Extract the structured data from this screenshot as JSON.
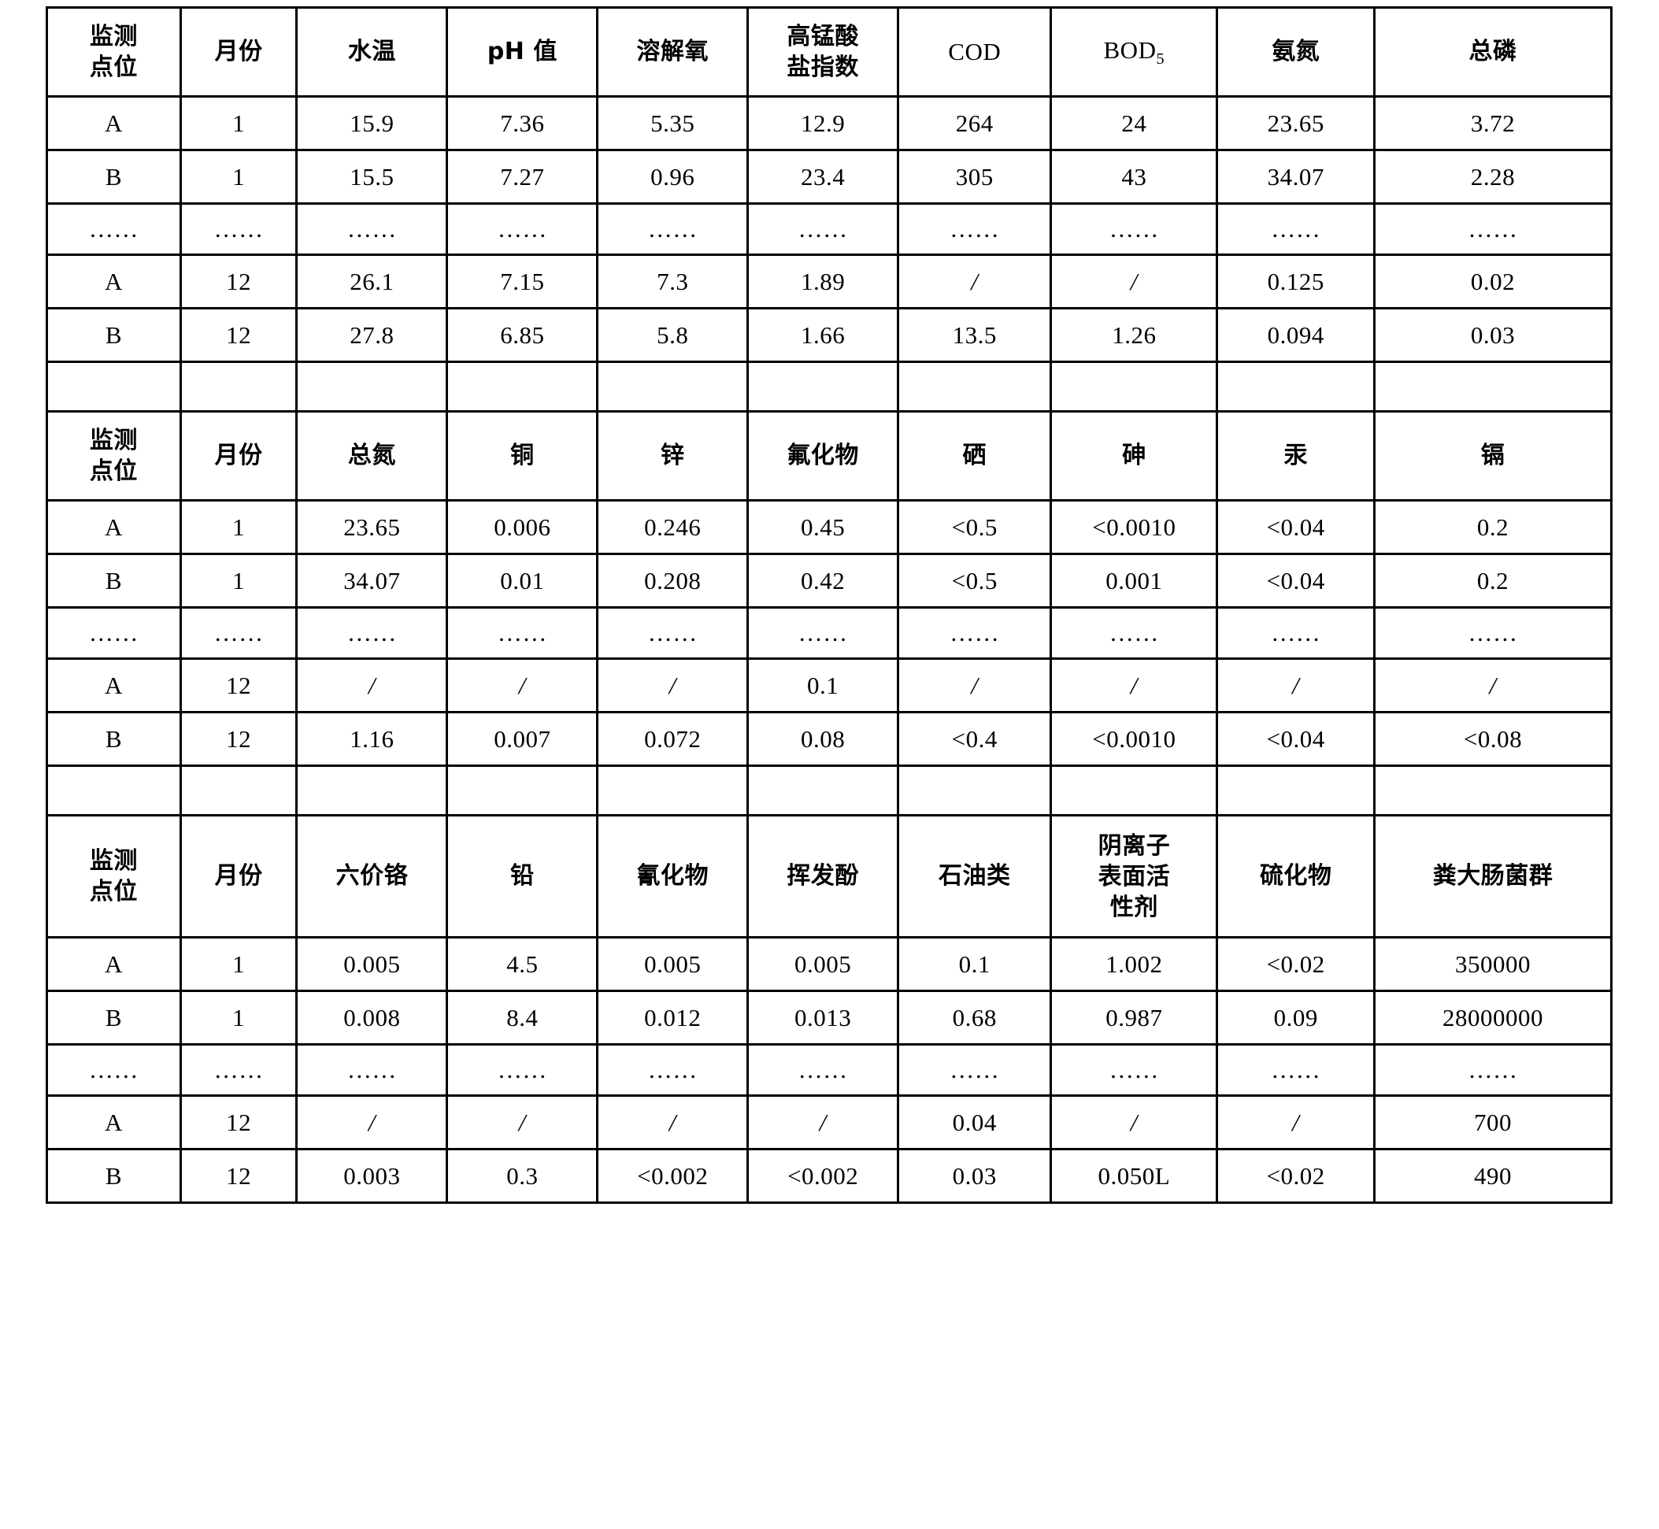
{
  "document": {
    "type": "water-quality-monitoring-data-tables",
    "table_count": 3
  },
  "tables": [
    {
      "id": "table-1",
      "headers": [
        "监测\n点位",
        "月份",
        "水温",
        "pH 值",
        "溶解氧",
        "高锰酸\n盐指数",
        "COD",
        "BOD5",
        "氨氮",
        "总磷"
      ],
      "header_lines": [
        [
          "监测",
          "点位"
        ],
        [
          "月份"
        ],
        [
          "水温"
        ],
        [
          "pH 值"
        ],
        [
          "溶解氧"
        ],
        [
          "高锰酸",
          "盐指数"
        ],
        [
          "COD"
        ],
        [
          "BOD",
          "5"
        ],
        [
          "氨氮"
        ],
        [
          "总磷"
        ]
      ],
      "rows": [
        [
          "A",
          "1",
          "15.9",
          "7.36",
          "5.35",
          "12.9",
          "264",
          "24",
          "23.65",
          "3.72"
        ],
        [
          "B",
          "1",
          "15.5",
          "7.27",
          "0.96",
          "23.4",
          "305",
          "43",
          "34.07",
          "2.28"
        ],
        [
          "……",
          "……",
          "……",
          "……",
          "……",
          "……",
          "……",
          "……",
          "……",
          "……"
        ],
        [
          "A",
          "12",
          "26.1",
          "7.15",
          "7.3",
          "1.89",
          "/",
          "/",
          "0.125",
          "0.02"
        ],
        [
          "B",
          "12",
          "27.8",
          "6.85",
          "5.8",
          "1.66",
          "13.5",
          "1.26",
          "0.094",
          "0.03"
        ]
      ]
    },
    {
      "id": "table-2",
      "headers": [
        "监测\n点位",
        "月份",
        "总氮",
        "铜",
        "锌",
        "氟化物",
        "硒",
        "砷",
        "汞",
        "镉"
      ],
      "header_lines": [
        [
          "监测",
          "点位"
        ],
        [
          "月份"
        ],
        [
          "总氮"
        ],
        [
          "铜"
        ],
        [
          "锌"
        ],
        [
          "氟化物"
        ],
        [
          "硒"
        ],
        [
          "砷"
        ],
        [
          "汞"
        ],
        [
          "镉"
        ]
      ],
      "rows": [
        [
          "A",
          "1",
          "23.65",
          "0.006",
          "0.246",
          "0.45",
          "<0.5",
          "<0.0010",
          "<0.04",
          "0.2"
        ],
        [
          "B",
          "1",
          "34.07",
          "0.01",
          "0.208",
          "0.42",
          "<0.5",
          "0.001",
          "<0.04",
          "0.2"
        ],
        [
          "……",
          "……",
          "……",
          "……",
          "……",
          "……",
          "……",
          "……",
          "……",
          "……"
        ],
        [
          "A",
          "12",
          "/",
          "/",
          "/",
          "0.1",
          "/",
          "/",
          "/",
          "/"
        ],
        [
          "B",
          "12",
          "1.16",
          "0.007",
          "0.072",
          "0.08",
          "<0.4",
          "<0.0010",
          "<0.04",
          "<0.08"
        ]
      ]
    },
    {
      "id": "table-3",
      "headers": [
        "监测\n点位",
        "月份",
        "六价铬",
        "铅",
        "氰化物",
        "挥发酚",
        "石油类",
        "阴离子\n表面活\n性剂",
        "硫化物",
        "粪大肠菌群"
      ],
      "header_lines": [
        [
          "监测",
          "点位"
        ],
        [
          "月份"
        ],
        [
          "六价铬"
        ],
        [
          "铅"
        ],
        [
          "氰化物"
        ],
        [
          "挥发酚"
        ],
        [
          "石油类"
        ],
        [
          "阴离子",
          "表面活",
          "性剂"
        ],
        [
          "硫化物"
        ],
        [
          "粪大肠菌群"
        ]
      ],
      "rows": [
        [
          "A",
          "1",
          "0.005",
          "4.5",
          "0.005",
          "0.005",
          "0.1",
          "1.002",
          "<0.02",
          "350000"
        ],
        [
          "B",
          "1",
          "0.008",
          "8.4",
          "0.012",
          "0.013",
          "0.68",
          "0.987",
          "0.09",
          "28000000"
        ],
        [
          "……",
          "……",
          "……",
          "……",
          "……",
          "……",
          "……",
          "……",
          "……",
          "……"
        ],
        [
          "A",
          "12",
          "/",
          "/",
          "/",
          "/",
          "0.04",
          "/",
          "/",
          "700"
        ],
        [
          "B",
          "12",
          "0.003",
          "0.3",
          "<0.002",
          "<0.002",
          "0.03",
          "0.050L",
          "<0.02",
          "490"
        ]
      ]
    }
  ],
  "colors": {
    "border": "#000000",
    "background": "#ffffff",
    "text": "#000000"
  }
}
